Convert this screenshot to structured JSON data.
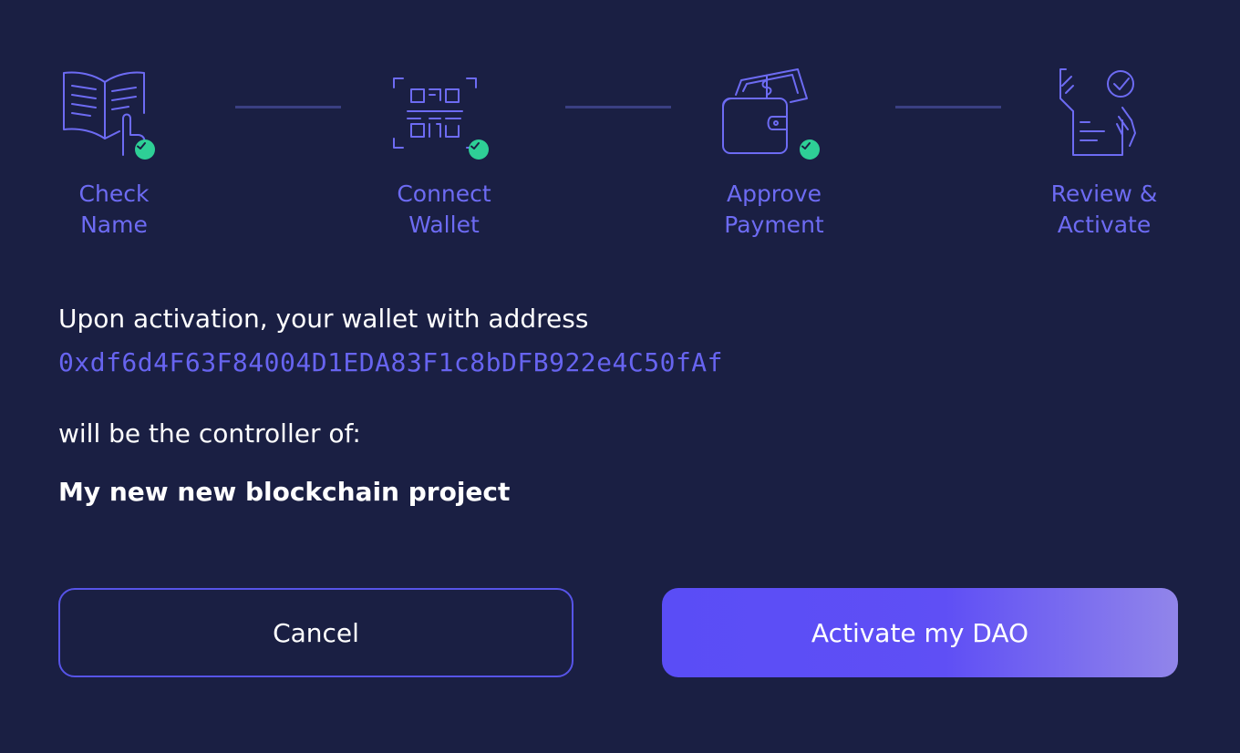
{
  "steps": [
    {
      "label": "Check\nName",
      "icon": "open-book-hand-icon",
      "completed": true
    },
    {
      "label": "Connect\nWallet",
      "icon": "qr-code-scan-icon",
      "completed": true
    },
    {
      "label": "Approve\nPayment",
      "icon": "wallet-cash-icon",
      "completed": true
    },
    {
      "label": "Review &\nActivate",
      "icon": "document-checkmark-hand-icon",
      "completed": false
    }
  ],
  "content": {
    "intro": "Upon activation, your wallet with address",
    "address": "0xdf6d4F63F84004D1EDA83F1c8bDFB922e4C50fAf",
    "controller_text": "will be the controller of:",
    "project_name": "My new new blockchain project"
  },
  "buttons": {
    "cancel_label": "Cancel",
    "activate_label": "Activate my DAO"
  },
  "colors": {
    "background": "#1a1f43",
    "accent": "#6d6bf3",
    "success": "#2ecf96",
    "connector": "#3a3f82"
  }
}
